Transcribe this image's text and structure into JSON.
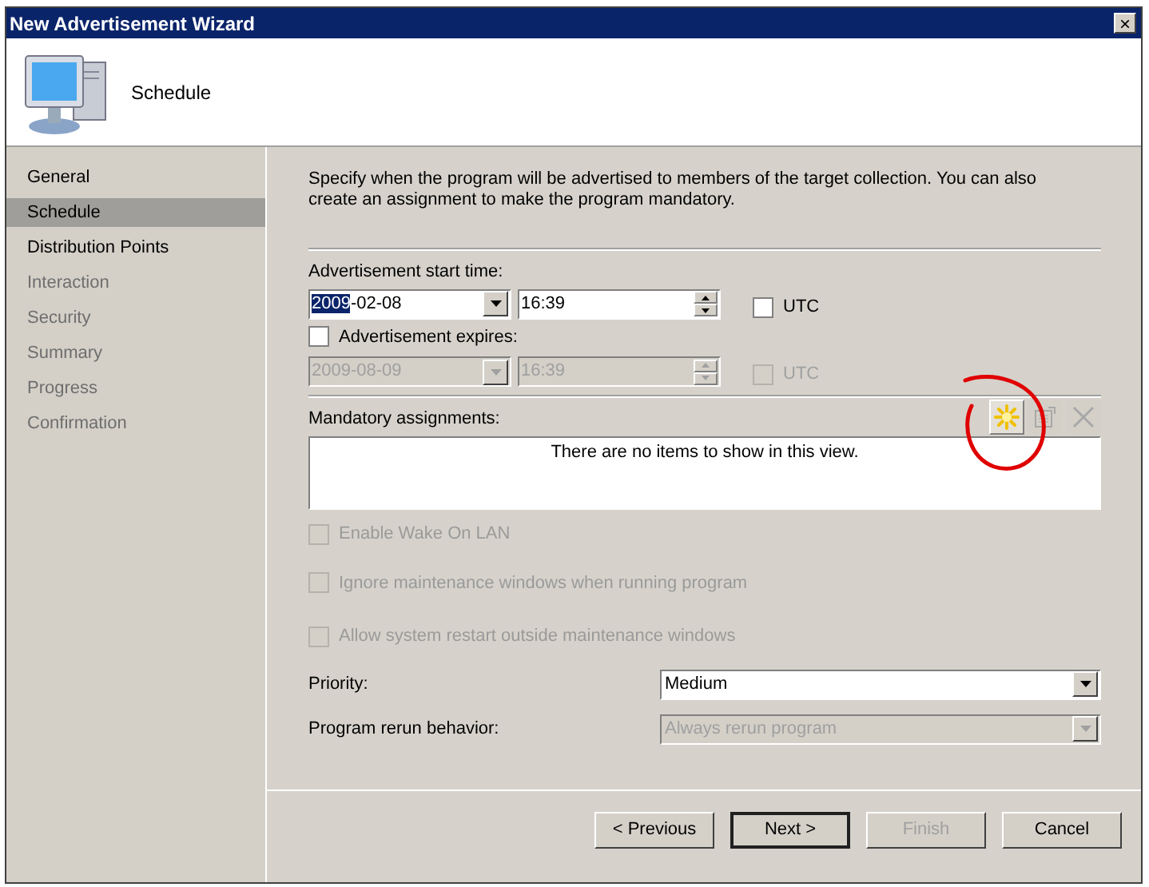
{
  "window": {
    "title": "New Advertisement Wizard",
    "close": "×"
  },
  "header": {
    "title": "Schedule"
  },
  "sidebar": {
    "items": [
      {
        "label": "General",
        "selected": false,
        "disabled": false
      },
      {
        "label": "Schedule",
        "selected": true,
        "disabled": false
      },
      {
        "label": "Distribution Points",
        "selected": false,
        "disabled": false
      },
      {
        "label": "Interaction",
        "selected": false,
        "disabled": true
      },
      {
        "label": "Security",
        "selected": false,
        "disabled": true
      },
      {
        "label": "Summary",
        "selected": false,
        "disabled": true
      },
      {
        "label": "Progress",
        "selected": false,
        "disabled": true
      },
      {
        "label": "Confirmation",
        "selected": false,
        "disabled": true
      }
    ]
  },
  "description": "Specify when the program will be advertised to members of the target collection. You can also create an assignment to make the program mandatory.",
  "start_time": {
    "label": "Advertisement start time:",
    "date_selected_part": "2009",
    "date_rest": "-02-08",
    "time": "16:39",
    "disabled": false,
    "utc": {
      "label": "UTC",
      "checked": false,
      "disabled": false
    }
  },
  "expires": {
    "label": "Advertisement expires:",
    "checked": false,
    "date": "2009-08-09",
    "time": "16:39",
    "disabled": true,
    "utc": {
      "label": "UTC",
      "checked": false,
      "disabled": true
    }
  },
  "mandatory": {
    "label": "Mandatory assignments:",
    "empty_text": "There are no items to show in this view.",
    "tools": [
      {
        "kind": "new",
        "disabled": false
      },
      {
        "kind": "properties",
        "disabled": true
      },
      {
        "kind": "delete",
        "disabled": true
      }
    ]
  },
  "options": [
    {
      "label": "Enable Wake On LAN",
      "checked": false,
      "disabled": true
    },
    {
      "label": "Ignore maintenance windows when running program",
      "checked": false,
      "disabled": true
    },
    {
      "label": "Allow system restart outside maintenance windows",
      "checked": false,
      "disabled": true
    }
  ],
  "priority": {
    "label": "Priority:",
    "value": "Medium",
    "disabled": false
  },
  "rerun": {
    "label": "Program rerun behavior:",
    "value": "Always rerun program",
    "disabled": true
  },
  "buttons": [
    {
      "label": "< Previous",
      "default": false,
      "disabled": false
    },
    {
      "label": "Next >",
      "default": true,
      "disabled": false
    },
    {
      "label": "Finish",
      "default": false,
      "disabled": true
    },
    {
      "label": "Cancel",
      "default": false,
      "disabled": false
    }
  ]
}
